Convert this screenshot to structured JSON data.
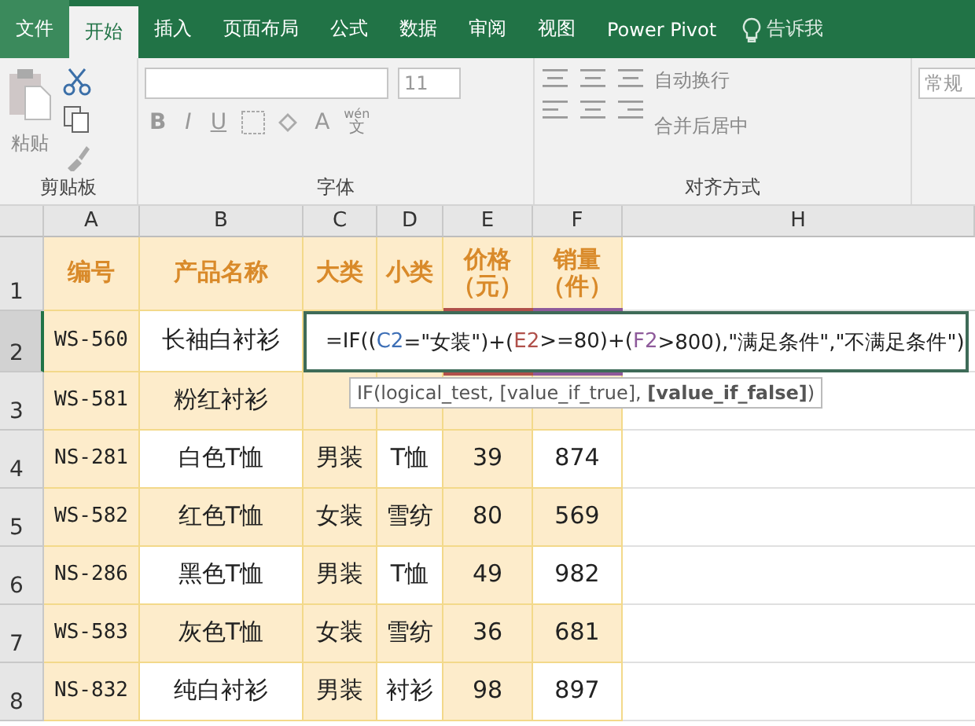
{
  "tabs": [
    {
      "label": "文件",
      "kind": "file",
      "selected": false
    },
    {
      "label": "开始",
      "kind": "tab",
      "selected": true
    },
    {
      "label": "插入",
      "kind": "tab",
      "selected": false
    },
    {
      "label": "页面布局",
      "kind": "tab",
      "selected": false
    },
    {
      "label": "公式",
      "kind": "tab",
      "selected": false
    },
    {
      "label": "数据",
      "kind": "tab",
      "selected": false
    },
    {
      "label": "审阅",
      "kind": "tab",
      "selected": false
    },
    {
      "label": "视图",
      "kind": "tab",
      "selected": false
    },
    {
      "label": "Power Pivot",
      "kind": "tab",
      "selected": false
    }
  ],
  "tell_me": "告诉我",
  "ribbon": {
    "paste": "粘贴",
    "clipboard_group": "剪贴板",
    "font_group": "字体",
    "font_size": "11",
    "bold": "B",
    "italic": "I",
    "underline": "U",
    "font_color": "A",
    "phonetic": [
      "wén",
      "文"
    ],
    "align_group": "对齐方式",
    "wrap_text": "自动换行",
    "merge_center": "合并后居中",
    "number_format": "常规"
  },
  "columns": [
    "A",
    "B",
    "C",
    "D",
    "E",
    "F",
    "H"
  ],
  "header_row": {
    "number": "1",
    "cells": [
      "编号",
      "产品名称",
      "大类",
      "小类",
      "价格（元）",
      "销量（件）"
    ]
  },
  "rows": [
    {
      "number": "2",
      "banded": true,
      "cells": [
        "WS-560",
        "长袖白衬衫"
      ]
    },
    {
      "number": "3",
      "banded": false,
      "cells": [
        "WS-581",
        "粉红衬衫"
      ]
    },
    {
      "number": "4",
      "banded": true,
      "cells": [
        "NS-281",
        "白色T恤",
        "男装",
        "T恤",
        "39",
        "874"
      ]
    },
    {
      "number": "5",
      "banded": false,
      "cells": [
        "WS-582",
        "红色T恤",
        "女装",
        "雪纺",
        "80",
        "569"
      ]
    },
    {
      "number": "6",
      "banded": true,
      "cells": [
        "NS-286",
        "黑色T恤",
        "男装",
        "T恤",
        "49",
        "982"
      ]
    },
    {
      "number": "7",
      "banded": false,
      "cells": [
        "WS-583",
        "灰色T恤",
        "女装",
        "雪纺",
        "36",
        "681"
      ]
    },
    {
      "number": "8",
      "banded": true,
      "cells": [
        "NS-832",
        "纯白衬衫",
        "男装",
        "衬衫",
        "98",
        "897"
      ]
    }
  ],
  "formula": [
    {
      "text": "=IF((",
      "color": "#222222"
    },
    {
      "text": "C2",
      "color": "#3d6fb6"
    },
    {
      "text": "=\"女装\")+(",
      "color": "#222222"
    },
    {
      "text": "E2",
      "color": "#b0504a"
    },
    {
      "text": ">=80)+(",
      "color": "#222222"
    },
    {
      "text": "F2",
      "color": "#8e5a9a"
    },
    {
      "text": ">800),\"满足条件\",\"不满足条件\")",
      "color": "#222222"
    }
  ],
  "tooltip": "IF(logical_test, [value_if_true], **[value_if_false]**)"
}
